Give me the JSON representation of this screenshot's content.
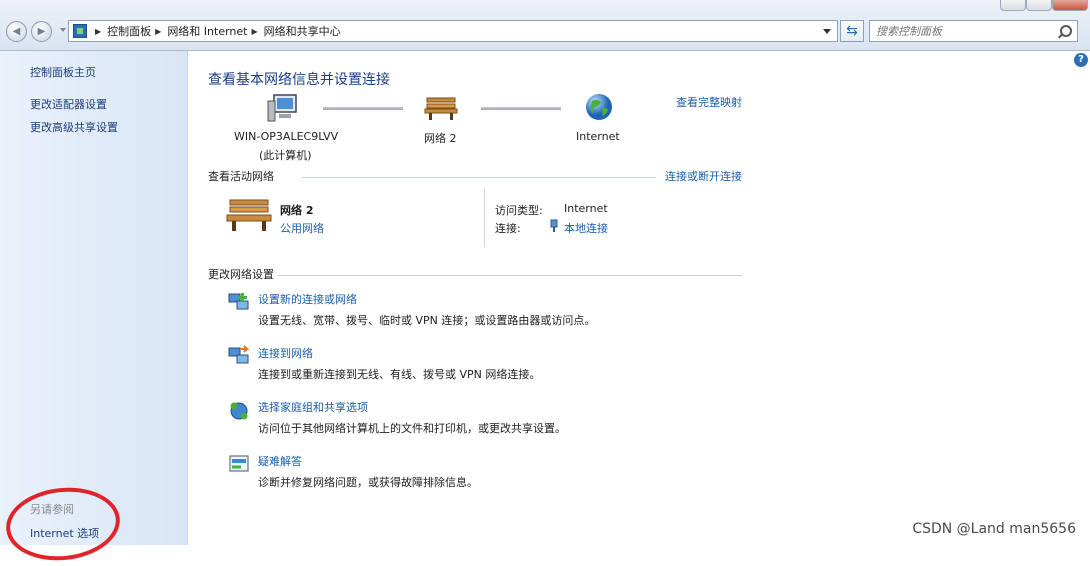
{
  "toolbar": {
    "breadcrumb": [
      "控制面板",
      "网络和 Internet",
      "网络和共享中心"
    ],
    "search_placeholder": "搜索控制面板"
  },
  "sidebar": {
    "items": [
      {
        "label": "控制面板主页"
      },
      {
        "label": "更改适配器设置"
      },
      {
        "label": "更改高级共享设置"
      }
    ],
    "see_also_heading": "另请参阅",
    "see_also_items": [
      {
        "label": "Internet 选项"
      }
    ]
  },
  "main": {
    "title": "查看基本网络信息并设置连接",
    "view_full_map": "查看完整映射",
    "map_nodes": [
      {
        "label": "WIN-OP3ALEC9LVV",
        "sublabel": "(此计算机)",
        "icon": "computer-icon"
      },
      {
        "label": "网络  2",
        "icon": "bench-icon"
      },
      {
        "label": "Internet",
        "icon": "globe-icon"
      }
    ],
    "active_networks": {
      "heading": "查看活动网络",
      "connect_link": "连接或断开连接",
      "network_name": "网络  2",
      "network_type": "公用网络",
      "access_type_label": "访问类型:",
      "access_type_value": "Internet",
      "connection_label": "连接:",
      "connection_value": "本地连接"
    },
    "change_settings": {
      "heading": "更改网络设置",
      "tasks": [
        {
          "link": "设置新的连接或网络",
          "desc": "设置无线、宽带、拨号、临时或 VPN 连接；或设置路由器或访问点。"
        },
        {
          "link": "连接到网络",
          "desc": "连接到或重新连接到无线、有线、拨号或 VPN 网络连接。"
        },
        {
          "link": "选择家庭组和共享选项",
          "desc": "访问位于其他网络计算机上的文件和打印机，或更改共享设置。"
        },
        {
          "link": "疑难解答",
          "desc": "诊断并修复网络问题，或获得故障排除信息。"
        }
      ]
    }
  },
  "watermark": "CSDN @Land man5656",
  "colors": {
    "link": "#1b5ea8",
    "title": "#1a3f86",
    "annotation_circle": "#e0242a"
  }
}
